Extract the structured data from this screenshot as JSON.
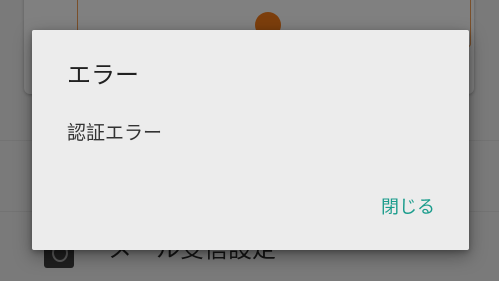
{
  "background": {
    "row_label": "メール受信設定"
  },
  "dialog": {
    "title": "エラー",
    "message": "認証エラー",
    "close_label": "閉じる"
  },
  "colors": {
    "accent": "#1a9c8c",
    "scrim": "#7f7f7f",
    "dialog_bg": "#ececec"
  }
}
